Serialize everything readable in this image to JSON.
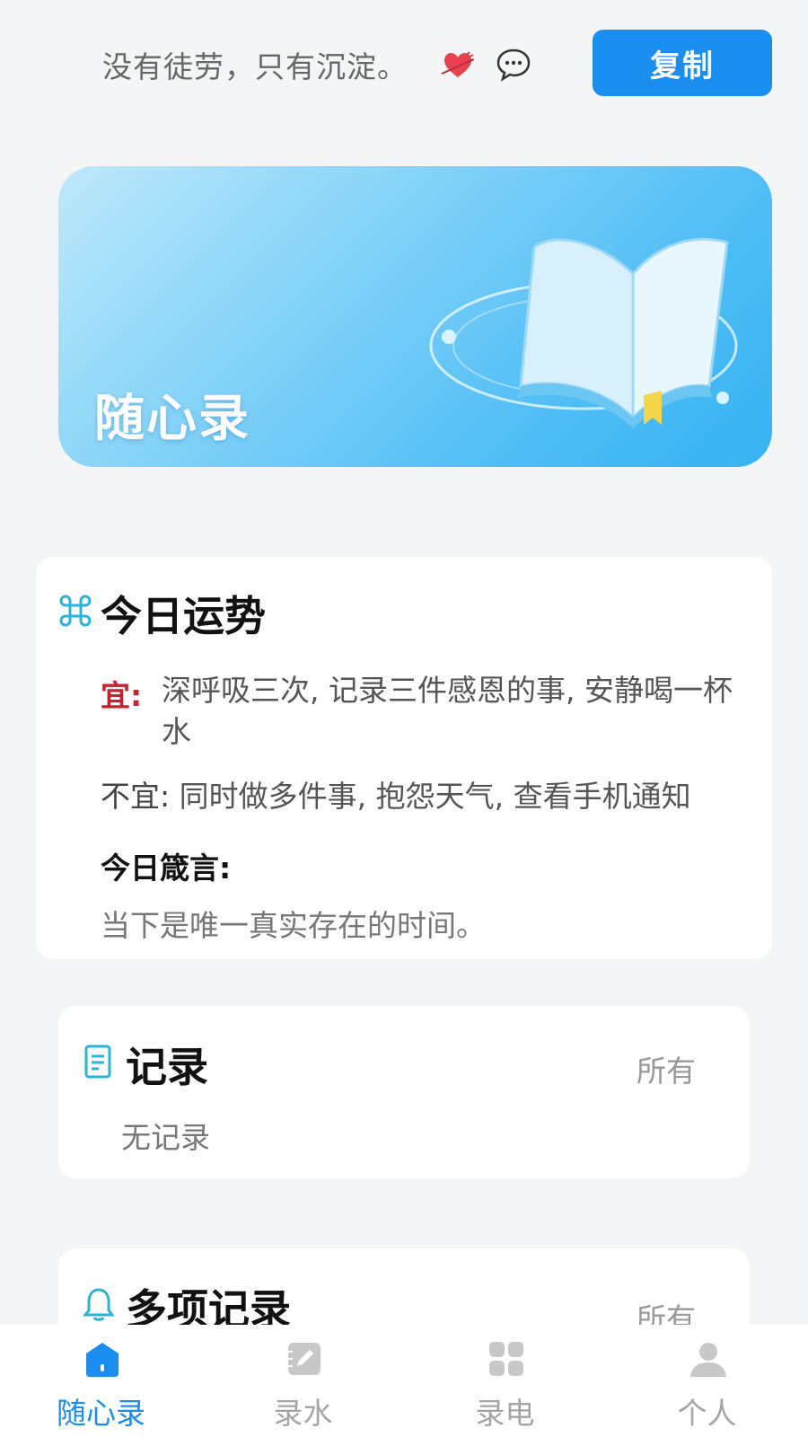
{
  "header": {
    "motto": "没有徒劳，只有沉淀。",
    "copy_label": "复制",
    "icons": [
      "heart-icon",
      "chat-bubble-icon"
    ]
  },
  "banner": {
    "title": "随心录"
  },
  "fortune": {
    "title": "今日运势",
    "yi_label": "宜:",
    "yi_text": "深呼吸三次, 记录三件感恩的事, 安静喝一杯水",
    "buyi_label": "不宜:",
    "buyi_text": "同时做多件事, 抱怨天气, 查看手机通知",
    "motto_label": "今日箴言:",
    "motto_text": "当下是唯一真实存在的时间。"
  },
  "records": {
    "title": "记录",
    "all_label": "所有",
    "empty_text": "无记录"
  },
  "multi_records": {
    "title": "多项记录",
    "all_label": "所有"
  },
  "nav": {
    "items": [
      {
        "label": "随心录",
        "icon": "home-icon",
        "active": true
      },
      {
        "label": "录水",
        "icon": "edit-icon",
        "active": false
      },
      {
        "label": "录电",
        "icon": "grid-icon",
        "active": false
      },
      {
        "label": "个人",
        "icon": "person-icon",
        "active": false
      }
    ]
  },
  "colors": {
    "accent": "#1a8ef0",
    "yi": "#c4232f",
    "background": "#f4f5f7"
  }
}
